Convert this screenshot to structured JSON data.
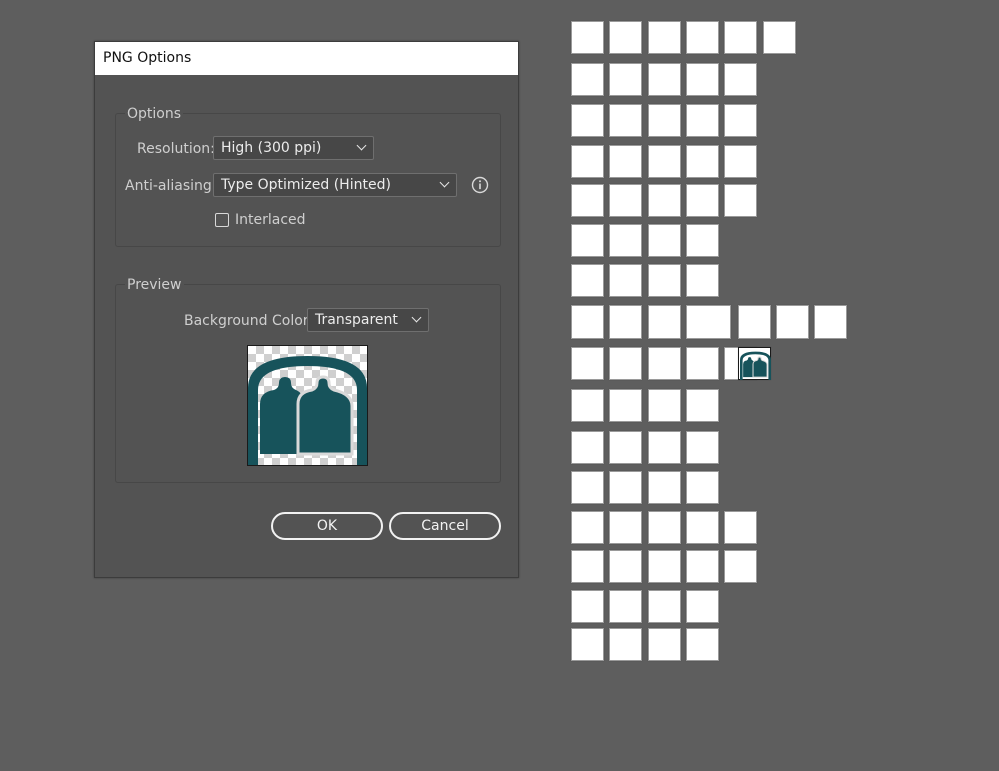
{
  "dialog": {
    "title": "PNG Options",
    "options_group": {
      "title": "Options",
      "resolution_label": "Resolution:",
      "resolution_value": "High (300 ppi)",
      "antialiasing_label": "Anti-aliasing:",
      "antialiasing_value": "Type Optimized (Hinted)",
      "interlaced_label": "Interlaced",
      "interlaced_checked": false,
      "info_icon": "info-icon"
    },
    "preview_group": {
      "title": "Preview",
      "background_label": "Background Color:",
      "background_value": "Transparent",
      "preview_image": "two-figures-under-arch"
    },
    "ok_label": "OK",
    "cancel_label": "Cancel"
  },
  "canvas": {
    "tile_rows": [
      6,
      5,
      5,
      5,
      5,
      4,
      4,
      7,
      5,
      4,
      4,
      4,
      5,
      5,
      4,
      4
    ],
    "artwork_tile": {
      "row": 9,
      "column": 5,
      "image": "two-figures-under-arch"
    }
  },
  "colors": {
    "artwork_teal": "#17535b",
    "background": "#5e5e5e",
    "dialog": "#535353"
  }
}
